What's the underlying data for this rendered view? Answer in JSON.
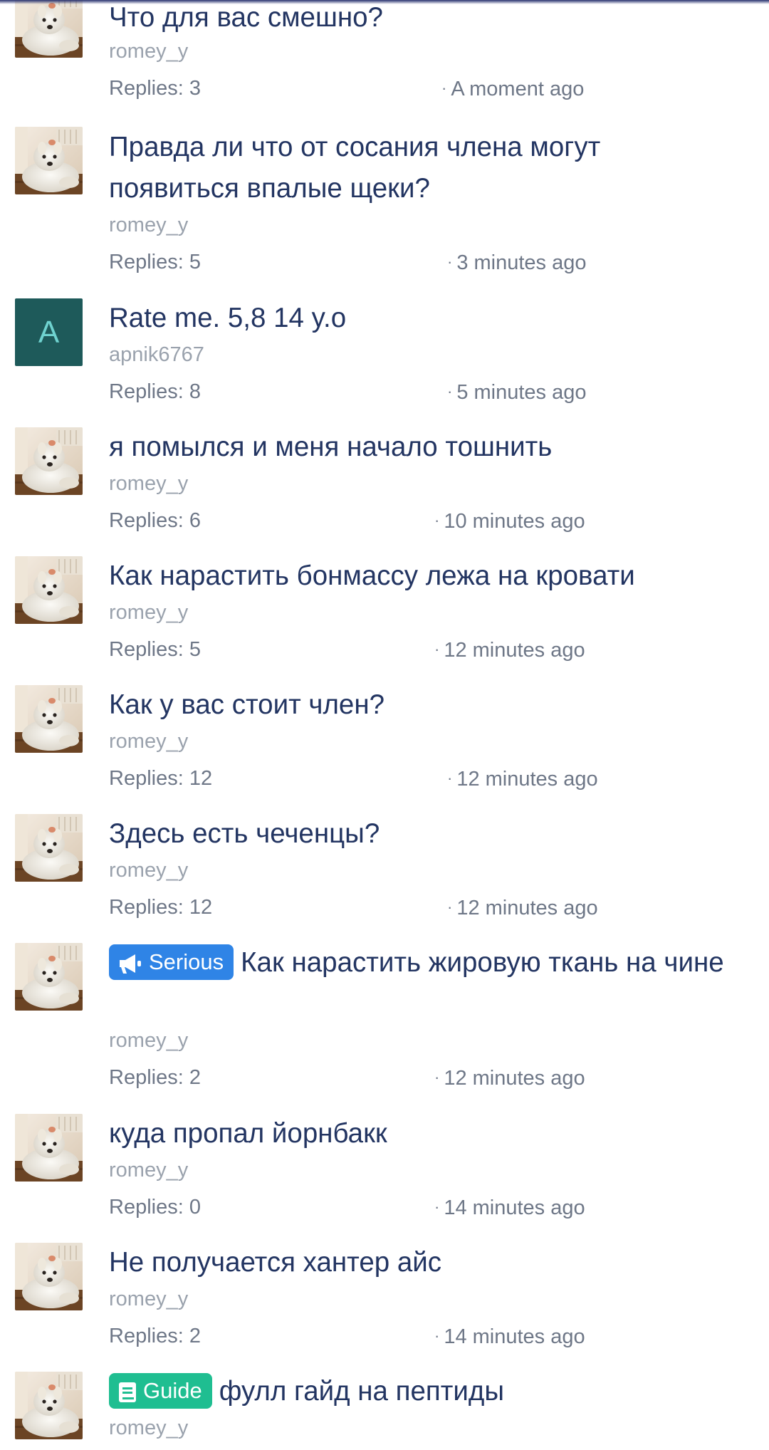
{
  "colors": {
    "title": "#233562",
    "author": "#9aa2ad",
    "meta": "#6e7787",
    "serious_badge": "#2f84e6",
    "guide_badge": "#1fbe91",
    "letter_avatar_bg": "#1e5a5a",
    "letter_avatar_fg": "#6fd2cf"
  },
  "threads": [
    {
      "title": "Что для вас смешно?",
      "author": "romey_y",
      "replies": "Replies: 3",
      "time": "A moment ago",
      "avatar": "dog-photo"
    },
    {
      "title": "Правда ли что от сосания члена могут появиться впалые щеки?",
      "author": "romey_y",
      "replies": "Replies: 5",
      "time": "3 minutes ago",
      "avatar": "dog-photo"
    },
    {
      "title": "Rate me. 5,8 14 y.o",
      "author": "apnik6767",
      "replies": "Replies: 8",
      "time": "5 minutes ago",
      "avatar": "letter",
      "avatar_letter": "A"
    },
    {
      "title": "я помылся и меня начало тошнить",
      "author": "romey_y",
      "replies": "Replies: 6",
      "time": "10 minutes ago",
      "avatar": "dog-photo"
    },
    {
      "title": "Как нарастить бонмассу лежа на кровати",
      "author": "romey_y",
      "replies": "Replies: 5",
      "time": "12 minutes ago",
      "avatar": "dog-photo"
    },
    {
      "title": "Как у вас стоит член?",
      "author": "romey_y",
      "replies": "Replies: 12",
      "time": "12 minutes ago",
      "avatar": "dog-photo"
    },
    {
      "title": "Здесь есть чеченцы?",
      "author": "romey_y",
      "replies": "Replies: 12",
      "time": "12 minutes ago",
      "avatar": "dog-photo"
    },
    {
      "badge": "Serious",
      "badge_icon": "megaphone-icon",
      "title": "Как нарастить жировую ткань на чине",
      "author": "romey_y",
      "replies": "Replies: 2",
      "time": "12 minutes ago",
      "avatar": "dog-photo"
    },
    {
      "title": "куда пропал йорнбакк",
      "author": "romey_y",
      "replies": "Replies: 0",
      "time": "14 minutes ago",
      "avatar": "dog-photo"
    },
    {
      "title": "Не получается хантер айс",
      "author": "romey_y",
      "replies": "Replies: 2",
      "time": "14 minutes ago",
      "avatar": "dog-photo"
    },
    {
      "badge": "Guide",
      "badge_icon": "book-icon",
      "title": "фулл гайд на пептиды",
      "author": "romey_y",
      "avatar": "dog-photo"
    }
  ]
}
